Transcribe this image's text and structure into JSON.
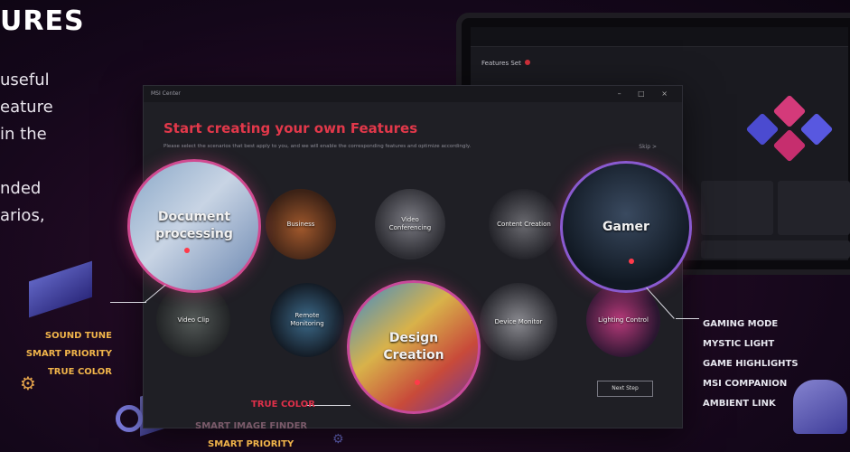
{
  "hero": {
    "title": "URES",
    "lines": [
      "useful",
      "eature",
      "in the",
      "",
      "nded",
      "arios,"
    ]
  },
  "laptop": {
    "label": "Features Set"
  },
  "window": {
    "titlebar": "MSI Center",
    "controls": "– □ ×",
    "heading": "Start creating your own Features",
    "subtitle": "Please select the scenarios that best apply to you, and we will enable the corresponding features and optimize accordingly.",
    "skip": "Skip >",
    "next_button": "Next Step"
  },
  "features": [
    {
      "label": "Document processing"
    },
    {
      "label": "Business"
    },
    {
      "label": "Video Conferencing"
    },
    {
      "label": "Content Creation"
    },
    {
      "label": "Gamer"
    },
    {
      "label": "Video Clip"
    },
    {
      "label": "Remote Monitoring"
    },
    {
      "label": "Design Creation"
    },
    {
      "label": "Device Monitor"
    },
    {
      "label": "Lighting Control"
    }
  ],
  "tags_left": [
    "SOUND TUNE",
    "SMART PRIORITY",
    "TRUE COLOR"
  ],
  "tag_true_color_red": "TRUE COLOR",
  "tags_bottom": [
    "SMART IMAGE FINDER",
    "SMART PRIORITY"
  ],
  "tags_right": [
    "GAMING MODE",
    "MYSTIC LIGHT",
    "GAME HIGHLIGHTS",
    "MSI COMPANION",
    "AMBIENT LINK"
  ],
  "colors": {
    "accent_red": "#e2384a",
    "tag_gold": "#f0b44a",
    "bubble_ring": "#c84a9a"
  }
}
